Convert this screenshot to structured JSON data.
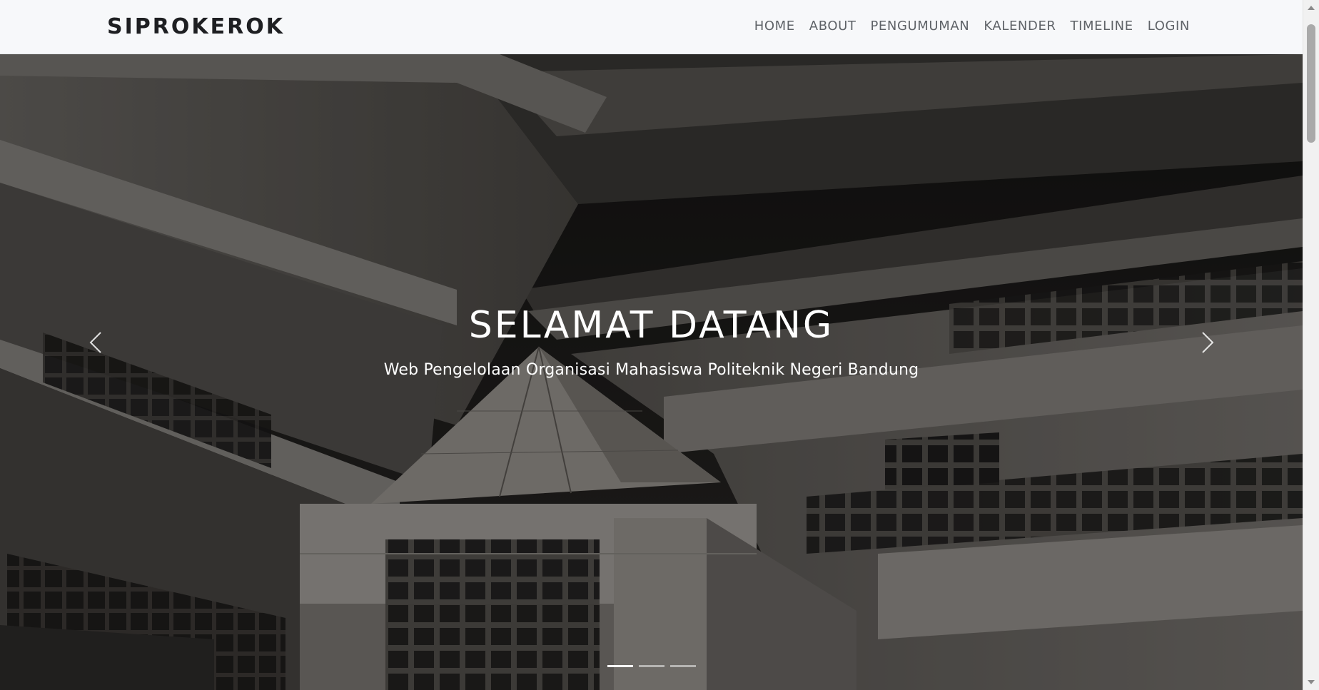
{
  "brand": "SIPROKEROK",
  "nav": {
    "items": [
      {
        "label": "HOME"
      },
      {
        "label": "ABOUT"
      },
      {
        "label": "PENGUMUMAN"
      },
      {
        "label": "KALENDER"
      },
      {
        "label": "TIMELINE"
      },
      {
        "label": "LOGIN"
      }
    ]
  },
  "hero": {
    "title": "SELAMAT DATANG",
    "subtitle": "Web Pengelolaan Organisasi Mahasiswa Politeknik Negeri Bandung",
    "active_slide": 1,
    "slide_count": 3,
    "background_image": "campus building photo (dimmed)"
  },
  "colors": {
    "navbar_bg": "#f7f8fa",
    "brand_text": "#1e1f22",
    "nav_text": "#5f6368",
    "hero_text": "#ffffff"
  },
  "icons": {
    "prev": "chevron-left-icon",
    "next": "chevron-right-icon"
  }
}
